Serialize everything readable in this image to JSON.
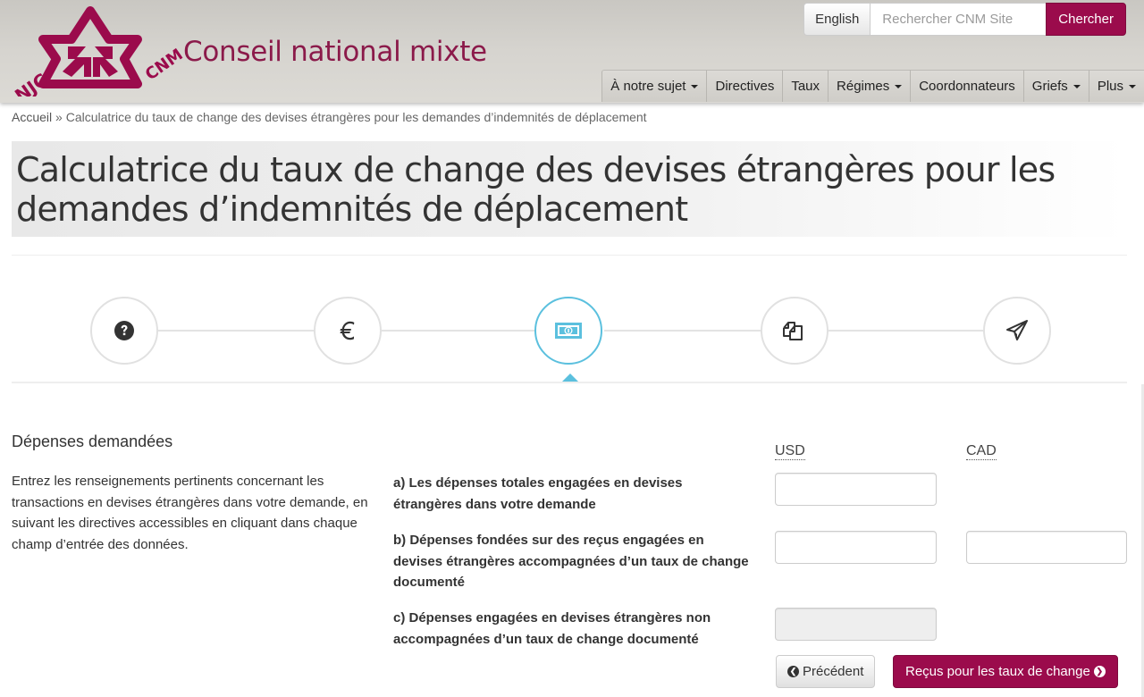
{
  "brand": {
    "site_title": "Conseil national mixte",
    "logo_left_text": "NJC",
    "logo_right_text": "CNM",
    "primary_color": "#9b0b4c",
    "accent_color": "#5bc0de"
  },
  "top_tools": {
    "language_label": "English",
    "search_placeholder": "Rechercher CNM Site",
    "search_value": "",
    "search_button": "Chercher"
  },
  "nav": {
    "items": [
      {
        "label": "À notre sujet",
        "dropdown": true
      },
      {
        "label": "Directives",
        "dropdown": false
      },
      {
        "label": "Taux",
        "dropdown": false
      },
      {
        "label": "Régimes",
        "dropdown": true
      },
      {
        "label": "Coordonnateurs",
        "dropdown": false
      },
      {
        "label": "Griefs",
        "dropdown": true
      },
      {
        "label": "Plus",
        "dropdown": true
      }
    ]
  },
  "breadcrumb": {
    "home": "Accueil",
    "separator": "»",
    "current": "Calculatrice du taux de change des devises étrangères pour les demandes d’indemnités de déplacement"
  },
  "page": {
    "title": "Calculatrice du taux de change des devises étrangères pour les demandes d’indemnités de déplacement"
  },
  "steps": [
    {
      "icon": "question-circle-icon",
      "active": false
    },
    {
      "icon": "euro-icon",
      "active": false
    },
    {
      "icon": "banknote-icon",
      "active": true
    },
    {
      "icon": "copy-documents-icon",
      "active": false
    },
    {
      "icon": "paper-plane-icon",
      "active": false
    }
  ],
  "section": {
    "title": "Dépenses demandées",
    "description": "Entrez les renseignements pertinents concernant les transactions en devises étrangères dans votre demande, en suivant les directives accessibles en cliquant dans chaque champ d’entrée des données."
  },
  "form": {
    "columns": {
      "usd": "USD",
      "cad": "CAD"
    },
    "rows": [
      {
        "label": "a) Les dépenses totales engagées en devises étrangères dans votre demande",
        "usd_value": "",
        "has_cad": false
      },
      {
        "label": "b) Dépenses fondées sur des reçus engagées en devises étrangères accompagnées d’un taux de change documenté",
        "usd_value": "",
        "cad_value": "",
        "has_cad": true
      },
      {
        "label": "c) Dépenses engagées en devises étrangères non accompagnées d’un taux de change documenté",
        "usd_value": "",
        "usd_disabled": true,
        "has_cad": false
      }
    ],
    "prev_button": "Précédent",
    "next_button": "Reçus pour les taux de change"
  }
}
